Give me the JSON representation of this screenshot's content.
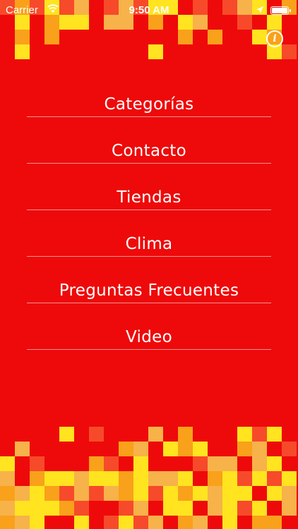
{
  "status_bar": {
    "carrier": "Carrier",
    "time": "9:50 AM"
  },
  "info_button": {
    "label": "i"
  },
  "menu": {
    "items": [
      {
        "label": "Categorías"
      },
      {
        "label": "Contacto"
      },
      {
        "label": "Tiendas"
      },
      {
        "label": "Clima"
      },
      {
        "label": "Preguntas Frecuentes"
      },
      {
        "label": "Video"
      }
    ]
  },
  "colors": {
    "background": "#ee0a0a",
    "tile_yellow": "#ffe41f",
    "tile_orange": "#f9a11a",
    "tile_red_light": "#f74a2a",
    "tile_tan": "#f7b24a",
    "text": "#ffffff"
  }
}
